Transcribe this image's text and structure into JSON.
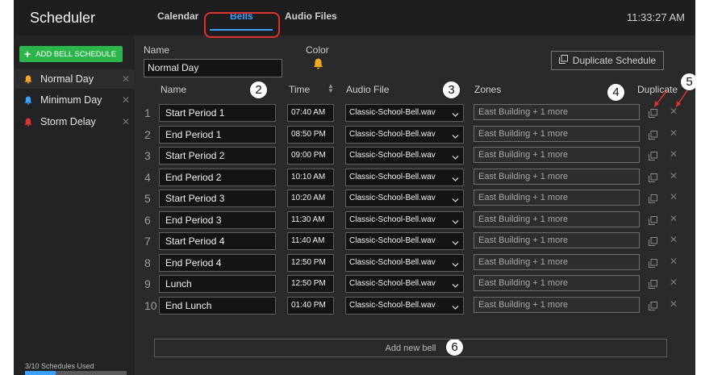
{
  "app": {
    "title": "Scheduler",
    "clock": "11:33:27 AM"
  },
  "tabs": [
    {
      "label": "Calendar",
      "active": false
    },
    {
      "label": "Bells",
      "active": true
    },
    {
      "label": "Audio Files",
      "active": false
    }
  ],
  "sidebar": {
    "add_button": "ADD BELL SCHEDULE",
    "items": [
      {
        "label": "Normal Day",
        "bell_color": "#f5a623",
        "selected": true
      },
      {
        "label": "Minimum Day",
        "bell_color": "#3aa1ff",
        "selected": false
      },
      {
        "label": "Storm Delay",
        "bell_color": "#e0322b",
        "selected": false
      }
    ],
    "usage_text": "3/10 Schedules Used",
    "usage_fraction": 0.3
  },
  "schedule": {
    "name_label": "Name",
    "name_value": "Normal Day",
    "color_label": "Color",
    "color_value": "#f5a623",
    "duplicate_schedule": "Duplicate Schedule"
  },
  "columns": {
    "name": "Name",
    "time": "Time",
    "audio": "Audio File",
    "zones": "Zones",
    "duplicate": "Duplicate"
  },
  "callouts": [
    "2",
    "3",
    "4",
    "5",
    "6"
  ],
  "bells": [
    {
      "num": "1",
      "name": "Start Period 1",
      "time": "07:40 AM",
      "audio": "Classic-School-Bell.wav",
      "zones": "East Building + 1 more"
    },
    {
      "num": "2",
      "name": "End Period 1",
      "time": "08:50 PM",
      "audio": "Classic-School-Bell.wav",
      "zones": "East Building + 1 more"
    },
    {
      "num": "3",
      "name": "Start Period 2",
      "time": "09:00 PM",
      "audio": "Classic-School-Bell.wav",
      "zones": "East Building + 1 more"
    },
    {
      "num": "4",
      "name": "End Period 2",
      "time": "10:10 AM",
      "audio": "Classic-School-Bell.wav",
      "zones": "East Building + 1 more"
    },
    {
      "num": "5",
      "name": "Start Period 3",
      "time": "10:20 AM",
      "audio": "Classic-School-Bell.wav",
      "zones": "East Building + 1 more"
    },
    {
      "num": "6",
      "name": "End Period 3",
      "time": "11:30 AM",
      "audio": "Classic-School-Bell.wav",
      "zones": "East Building + 1 more"
    },
    {
      "num": "7",
      "name": "Start Period 4",
      "time": "11:40 AM",
      "audio": "Classic-School-Bell.wav",
      "zones": "East Building + 1 more"
    },
    {
      "num": "8",
      "name": "End Period 4",
      "time": "12:50 PM",
      "audio": "Classic-School-Bell.wav",
      "zones": "East Building + 1 more"
    },
    {
      "num": "9",
      "name": "Lunch",
      "time": "12:50 PM",
      "audio": "Classic-School-Bell.wav",
      "zones": "East Building + 1 more"
    },
    {
      "num": "10",
      "name": "End Lunch",
      "time": "01:40 PM",
      "audio": "Classic-School-Bell.wav",
      "zones": "East Building + 1 more"
    }
  ],
  "add_bell": "Add new bell",
  "icons": {
    "bell": "bell-icon",
    "copy": "copy-icon",
    "delete": "close-icon",
    "chevron": "chevron-down-icon",
    "sort": "sort-icon",
    "plus": "plus-icon"
  },
  "colors": {
    "accent": "#3aa1ff",
    "add_green": "#2bb54a",
    "highlight_red": "#e0322b",
    "bell_orange": "#f5a623"
  }
}
